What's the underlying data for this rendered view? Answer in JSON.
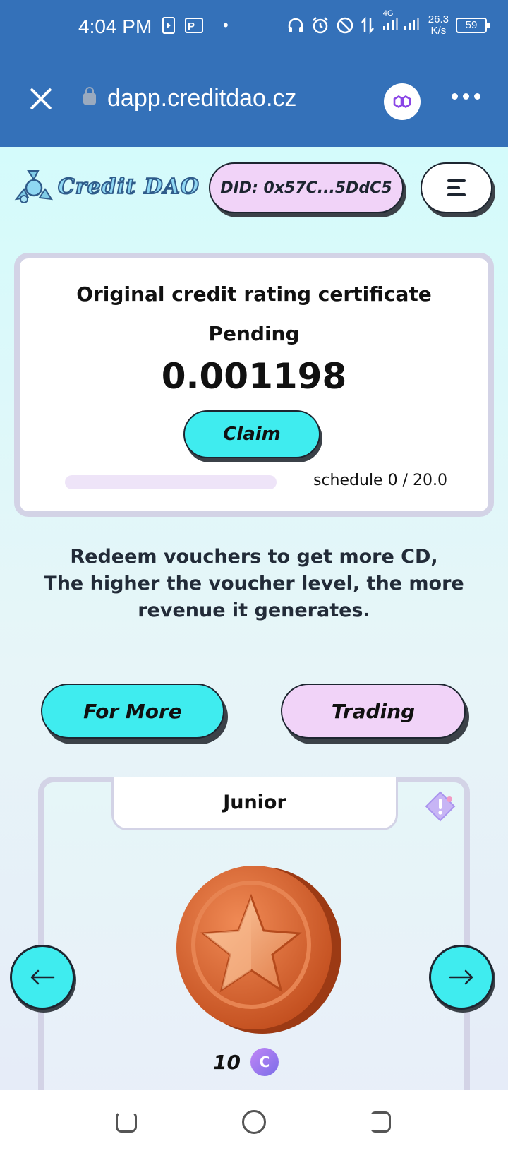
{
  "status_bar": {
    "time": "4:04 PM",
    "network_type": "4G",
    "net_speed_value": "26.3",
    "net_speed_unit": "K/s",
    "battery": "59"
  },
  "browser": {
    "url": "dapp.creditdao.cz",
    "close_icon": "close-icon",
    "wallet_icon": "polygon-icon",
    "more_icon": "more-dots-icon"
  },
  "header": {
    "logo_text": "Credit DAO",
    "did_label": "DID: 0x57C...5DdC5",
    "menu_icon": "hamburger-icon"
  },
  "certificate_card": {
    "title": "Original credit rating certificate",
    "status": "Pending",
    "amount": "0.001198",
    "claim_label": "Claim",
    "schedule_text": "schedule 0 / 20.0",
    "progress_fraction": 0
  },
  "promo": {
    "line1": "Redeem vouchers to get more CD,",
    "line2": "The higher the voucher level, the more revenue it generates."
  },
  "actions": {
    "for_more_label": "For More",
    "trading_label": "Trading"
  },
  "voucher": {
    "level": "Junior",
    "price": "10",
    "token_symbol": "C",
    "coin_icon": "star-coin-icon",
    "warn_icon": "warning-diamond-icon"
  },
  "colors": {
    "header_blue": "#3471b9",
    "cyan_button": "#3fecef",
    "lilac_button": "#f1d3f8",
    "coin_orange": "#d9632e"
  }
}
